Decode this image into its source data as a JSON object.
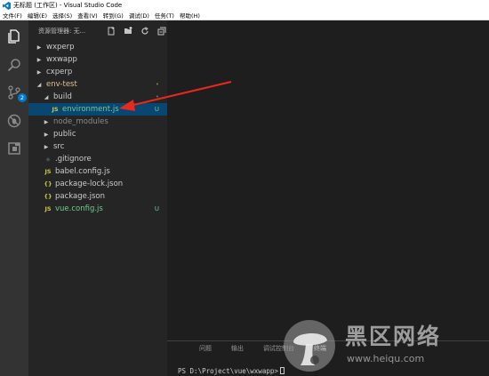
{
  "window": {
    "title": "无标题 (工作区) - Visual Studio Code"
  },
  "menu": {
    "items": [
      "文件(F)",
      "编辑(E)",
      "选择(S)",
      "查看(V)",
      "转到(G)",
      "调试(D)",
      "任务(T)",
      "帮助(H)"
    ]
  },
  "activity": {
    "scm_badge": "2"
  },
  "explorer": {
    "title": "资源管理器: 无..."
  },
  "tree": [
    {
      "label": "wxperp",
      "arrow": "▶",
      "icon": "",
      "status": ""
    },
    {
      "label": "wxwapp",
      "arrow": "▶",
      "icon": "",
      "status": ""
    },
    {
      "label": "cxperp",
      "arrow": "▶",
      "icon": "",
      "status": ""
    },
    {
      "label": "env-test",
      "arrow": "◢",
      "icon": "",
      "status": "•"
    },
    {
      "label": "build",
      "arrow": "◢",
      "icon": "",
      "status": "•"
    },
    {
      "label": "environment.js",
      "arrow": "",
      "icon": "JS",
      "status": "U"
    },
    {
      "label": "node_modules",
      "arrow": "▶",
      "icon": "",
      "status": ""
    },
    {
      "label": "public",
      "arrow": "▶",
      "icon": "",
      "status": ""
    },
    {
      "label": "src",
      "arrow": "▶",
      "icon": "",
      "status": ""
    },
    {
      "label": ".gitignore",
      "arrow": "",
      "icon": "◆",
      "status": ""
    },
    {
      "label": "babel.config.js",
      "arrow": "",
      "icon": "JS",
      "status": ""
    },
    {
      "label": "package-lock.json",
      "arrow": "",
      "icon": "{}",
      "status": ""
    },
    {
      "label": "package.json",
      "arrow": "",
      "icon": "{}",
      "status": ""
    },
    {
      "label": "vue.config.js",
      "arrow": "",
      "icon": "JS",
      "status": "U"
    }
  ],
  "panel": {
    "tabs": [
      "问题",
      "输出",
      "调试控制台",
      "终端"
    ],
    "terminal_line": "PS D:\\Project\\vue\\wxwapp>"
  },
  "watermark": {
    "title": "黑区网络",
    "url": "www.heiqu.com"
  },
  "colors": {
    "accent": "#007acc",
    "selection": "#094771",
    "modified": "#e2c08d",
    "untracked": "#73c991",
    "arrow_annotation": "#e8291c"
  }
}
